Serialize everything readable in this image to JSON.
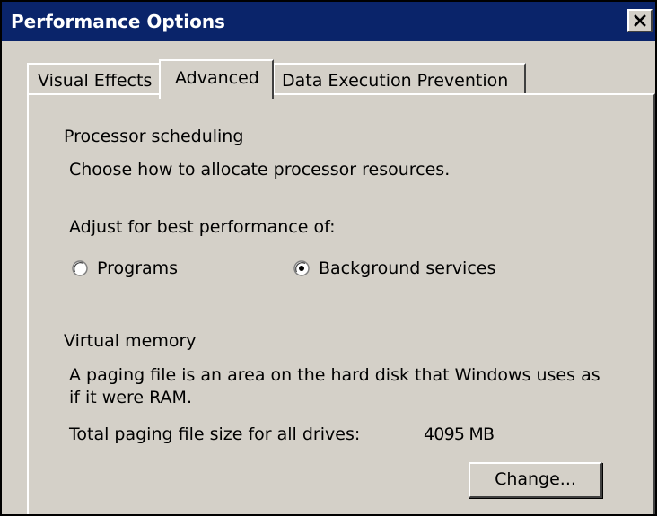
{
  "window": {
    "title": "Performance Options",
    "close_icon": "close-x-icon"
  },
  "colors": {
    "title_bar": "#0a246a",
    "dialog_face": "#d4d0c8"
  },
  "tabs": [
    {
      "label": "Visual Effects",
      "selected": false
    },
    {
      "label": "Advanced",
      "selected": true
    },
    {
      "label": "Data Execution Prevention",
      "selected": false
    }
  ],
  "processor_scheduling": {
    "legend": "Processor scheduling",
    "description": "Choose how to allocate processor resources.",
    "adjust_label": "Adjust for best performance of:",
    "options": [
      {
        "label": "Programs",
        "checked": false
      },
      {
        "label": "Background services",
        "checked": true
      }
    ]
  },
  "virtual_memory": {
    "legend": "Virtual memory",
    "description_line1": "A paging file is an area on the hard disk that Windows uses as",
    "description_line2": "if it were RAM.",
    "total_label": "Total paging file size for all drives:",
    "total_value": "4095 MB",
    "change_button": "Change..."
  }
}
